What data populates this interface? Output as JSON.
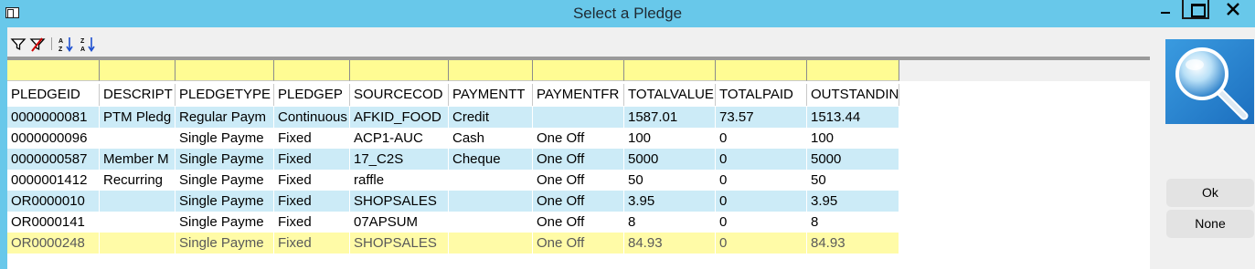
{
  "window": {
    "title": "Select a Pledge"
  },
  "toolbar": {
    "icons": [
      "filter-icon",
      "clear-filter-icon",
      "sort-ascending-icon",
      "sort-descending-icon"
    ]
  },
  "grid": {
    "columns": [
      "PLEDGEID",
      "DESCRIPT",
      "PLEDGETYPE",
      "PLEDGEP",
      "SOURCECOD",
      "PAYMENTT",
      "PAYMENTFR",
      "TOTALVALUE",
      "TOTALPAID",
      "OUTSTANDIN"
    ],
    "rows": [
      [
        "0000000081",
        "PTM Pledg",
        "Regular Paym",
        "Continuous",
        "AFKID_FOOD",
        "Credit",
        "",
        "1587.01",
        "73.57",
        "1513.44"
      ],
      [
        "0000000096",
        "",
        "Single Payme",
        "Fixed",
        "ACP1-AUC",
        "Cash",
        "One Off",
        "100",
        "0",
        "100"
      ],
      [
        "0000000587",
        "Member M",
        "Single Payme",
        "Fixed",
        "17_C2S",
        "Cheque",
        "One Off",
        "5000",
        "0",
        "5000"
      ],
      [
        "0000001412",
        "Recurring",
        "Single Payme",
        "Fixed",
        "raffle",
        "",
        "One Off",
        "50",
        "0",
        "50"
      ],
      [
        "OR0000010",
        "",
        "Single Payme",
        "Fixed",
        "SHOPSALES",
        "",
        "One Off",
        "3.95",
        "0",
        "3.95"
      ],
      [
        "OR0000141",
        "",
        "Single Payme",
        "Fixed",
        "07APSUM",
        "",
        "One Off",
        "8",
        "0",
        "8"
      ],
      [
        "OR0000248",
        "",
        "Single Payme",
        "Fixed",
        "SHOPSALES",
        "",
        "One Off",
        "84.93",
        "0",
        "84.93"
      ]
    ],
    "selected_row": 6
  },
  "buttons": {
    "ok": "Ok",
    "none": "None"
  },
  "colors": {
    "titlebar": "#68c8ea",
    "filter_row": "#fffc93",
    "alt_row": "#ccebf7",
    "selected_row": "#fffba7"
  }
}
